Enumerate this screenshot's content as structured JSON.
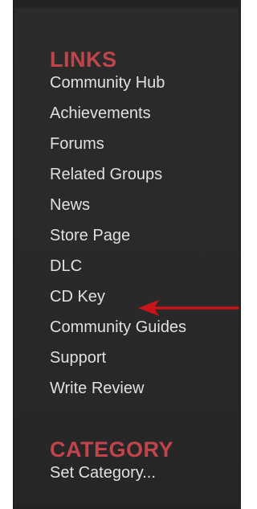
{
  "links": {
    "heading": "LINKS",
    "items": [
      {
        "label": "Community Hub"
      },
      {
        "label": "Achievements"
      },
      {
        "label": "Forums"
      },
      {
        "label": "Related Groups"
      },
      {
        "label": "News"
      },
      {
        "label": "Store Page"
      },
      {
        "label": "DLC"
      },
      {
        "label": "CD Key"
      },
      {
        "label": "Community Guides"
      },
      {
        "label": "Support"
      },
      {
        "label": "Write Review"
      }
    ]
  },
  "category": {
    "heading": "CATEGORY",
    "items": [
      {
        "label": "Set Category..."
      }
    ]
  },
  "annotation": {
    "arrow_icon": "left-arrow-icon",
    "arrow_color": "#c8141b"
  },
  "colors": {
    "panel_bg": "#2a2a2a",
    "heading": "#c2444b",
    "link_text": "#e0e0e0"
  }
}
